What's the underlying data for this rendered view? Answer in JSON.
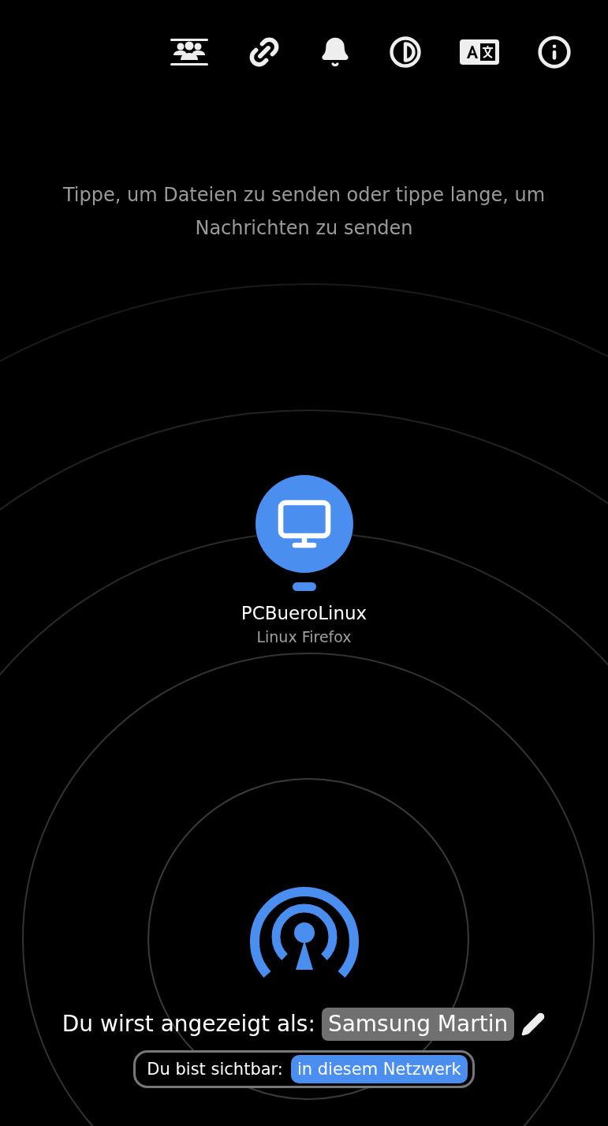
{
  "hint": "Tippe, um Dateien zu senden oder tippe lange, um Nachrichten zu senden",
  "devices": [
    {
      "name": "PCBueroLinux",
      "platform": "Linux Firefox"
    }
  ],
  "display_name": {
    "label": "Du wirst angezeigt als:",
    "value": "Samsung Martin"
  },
  "visibility": {
    "label": "Du bist sichtbar:",
    "value": "in diesem Netzwerk"
  }
}
